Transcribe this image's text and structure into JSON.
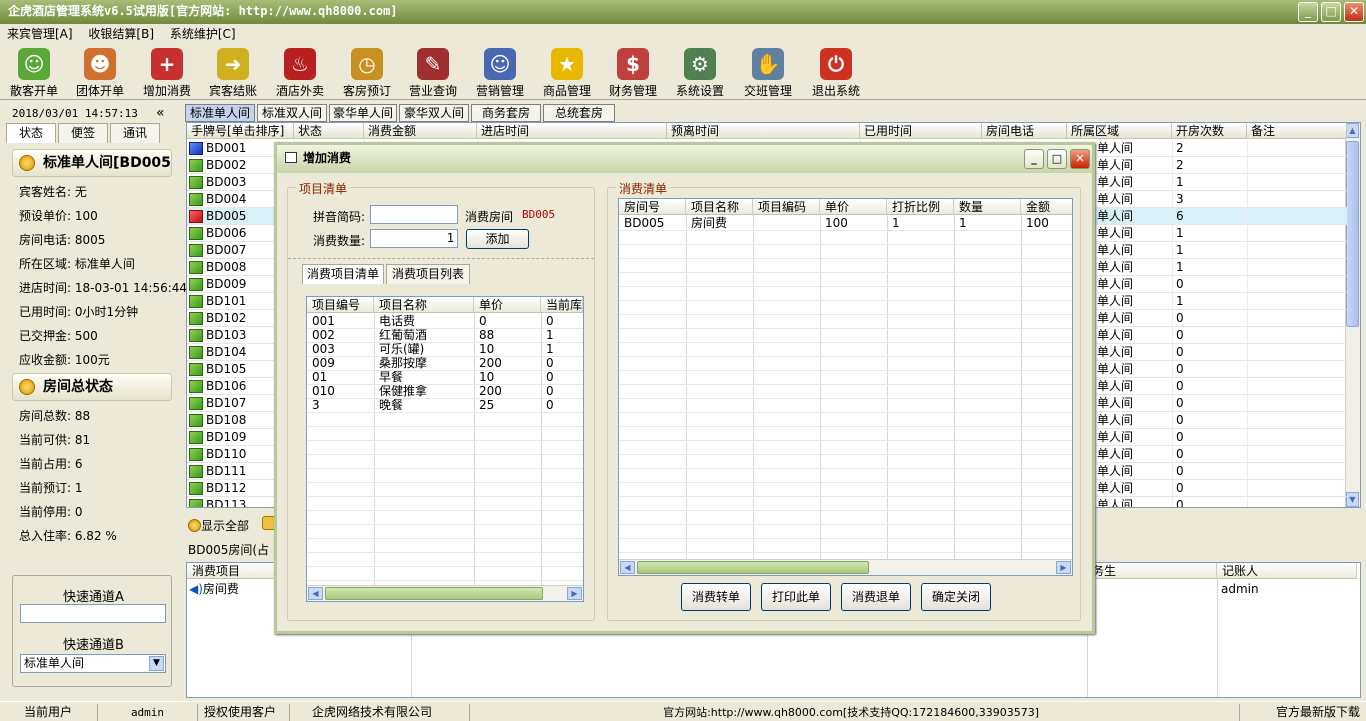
{
  "app": {
    "title": "企虎酒店管理系统v6.5试用版[官方网站: http://www.qh8000.com]"
  },
  "window_buttons": {
    "min": "_",
    "max": "□",
    "close": "✕"
  },
  "menu": [
    "来宾管理[A]",
    "收银结算[B]",
    "系统维护[C]"
  ],
  "toolbar": [
    {
      "label": "散客开单",
      "icon": "person-icon",
      "color": "#5aa838"
    },
    {
      "label": "团体开单",
      "icon": "group-icon",
      "color": "#d07030"
    },
    {
      "label": "增加消费",
      "icon": "add-cart-icon",
      "color": "#c83030"
    },
    {
      "label": "宾客结账",
      "icon": "arrow-icon",
      "color": "#d0b020"
    },
    {
      "label": "酒店外卖",
      "icon": "food-icon",
      "color": "#b82020"
    },
    {
      "label": "客房预订",
      "icon": "clock-icon",
      "color": "#c89020"
    },
    {
      "label": "营业查询",
      "icon": "query-icon",
      "color": "#a03030"
    },
    {
      "label": "营销管理",
      "icon": "people-icon",
      "color": "#4868b0"
    },
    {
      "label": "商品管理",
      "icon": "star-icon",
      "color": "#e8b800"
    },
    {
      "label": "财务管理",
      "icon": "finance-icon",
      "color": "#c04040"
    },
    {
      "label": "系统设置",
      "icon": "settings-icon",
      "color": "#508050"
    },
    {
      "label": "交班管理",
      "icon": "handshake-icon",
      "color": "#6080a0"
    },
    {
      "label": "退出系统",
      "icon": "power-icon",
      "color": "#d03020"
    }
  ],
  "left": {
    "datetime": "2018/03/01 14:57:13",
    "collapse": "«",
    "tabs": [
      "状态",
      "便签",
      "通讯"
    ],
    "room_title": "标准单人间[BD005",
    "room_fields": [
      "宾客姓名: 无",
      "预设单价: 100",
      "房间电话: 8005",
      "所在区域: 标准单人间",
      "进店时间: 18-03-01 14:56:44",
      "已用时间: 0小时1分钟",
      "已交押金: 500",
      "应收金额: 100元"
    ],
    "status_title": "房间总状态",
    "status_fields": [
      "房间总数: 88",
      "当前可供: 81",
      "当前占用: 6",
      "当前预订: 1",
      "当前停用: 0",
      "总入住率: 6.82 %"
    ],
    "fast_a_label": "快速通道A",
    "fast_a_value": "",
    "fast_b_label": "快速通道B",
    "fast_b_value": "标准单人间"
  },
  "room_tabs": [
    "标准单人间",
    "标准双人间",
    "豪华单人间",
    "豪华双人间",
    "商务套房",
    "总统套房"
  ],
  "grid": {
    "headers": [
      "手牌号[单击排序]",
      "状态",
      "消费金额",
      "进店时间",
      "预离时间",
      "已用时间",
      "房间电话",
      "所属区域",
      "开房次数",
      "备注"
    ],
    "rows": [
      {
        "id": "BD001",
        "area": "单人间",
        "count": "2",
        "color": "blue"
      },
      {
        "id": "BD002",
        "area": "单人间",
        "count": "2",
        "color": "green"
      },
      {
        "id": "BD003",
        "area": "单人间",
        "count": "1",
        "color": "green"
      },
      {
        "id": "BD004",
        "area": "单人间",
        "count": "3",
        "color": "green"
      },
      {
        "id": "BD005",
        "area": "单人间",
        "count": "6",
        "color": "red"
      },
      {
        "id": "BD006",
        "area": "单人间",
        "count": "1",
        "color": "green"
      },
      {
        "id": "BD007",
        "area": "单人间",
        "count": "1",
        "color": "green"
      },
      {
        "id": "BD008",
        "area": "单人间",
        "count": "1",
        "color": "green"
      },
      {
        "id": "BD009",
        "area": "单人间",
        "count": "0",
        "color": "green"
      },
      {
        "id": "BD101",
        "area": "单人间",
        "count": "1",
        "color": "green"
      },
      {
        "id": "BD102",
        "area": "单人间",
        "count": "0",
        "color": "green"
      },
      {
        "id": "BD103",
        "area": "单人间",
        "count": "0",
        "color": "green"
      },
      {
        "id": "BD104",
        "area": "单人间",
        "count": "0",
        "color": "green"
      },
      {
        "id": "BD105",
        "area": "单人间",
        "count": "0",
        "color": "green"
      },
      {
        "id": "BD106",
        "area": "单人间",
        "count": "0",
        "color": "green"
      },
      {
        "id": "BD107",
        "area": "单人间",
        "count": "0",
        "color": "green"
      },
      {
        "id": "BD108",
        "area": "单人间",
        "count": "0",
        "color": "green"
      },
      {
        "id": "BD109",
        "area": "单人间",
        "count": "0",
        "color": "green"
      },
      {
        "id": "BD110",
        "area": "单人间",
        "count": "0",
        "color": "green"
      },
      {
        "id": "BD111",
        "area": "单人间",
        "count": "0",
        "color": "green"
      },
      {
        "id": "BD112",
        "area": "单人间",
        "count": "0",
        "color": "green"
      },
      {
        "id": "BD113",
        "area": "单人间",
        "count": "0",
        "color": "green"
      }
    ]
  },
  "bottom": {
    "show_all": "显示全部",
    "room_info": "BD005房间(占",
    "headers": [
      "消费项目",
      "务生",
      "记账人"
    ],
    "row": {
      "item": "房间费",
      "user": "admin"
    }
  },
  "dialog": {
    "title": "增加消费",
    "project_group": "项目清单",
    "pinyin_label": "拼音简码:",
    "pinyin_value": "",
    "room_label": "消费房间",
    "room_value": "BD005",
    "qty_label": "消费数量:",
    "qty_value": "1",
    "add_button": "添加",
    "tabs": [
      "消费项目清单",
      "消费项目列表"
    ],
    "items_headers": [
      "项目编号",
      "项目名称",
      "单价",
      "当前库"
    ],
    "items": [
      [
        "001",
        "电话费",
        "0",
        "0"
      ],
      [
        "002",
        "红葡萄酒",
        "88",
        "1"
      ],
      [
        "003",
        "可乐(罐)",
        "10",
        "1"
      ],
      [
        "009",
        "桑那按摩",
        "200",
        "0"
      ],
      [
        "01",
        "早餐",
        "10",
        "0"
      ],
      [
        "010",
        "保健推拿",
        "200",
        "0"
      ],
      [
        "3",
        "晚餐",
        "25",
        "0"
      ]
    ],
    "consume_group": "消费清单",
    "consume_headers": [
      "房间号",
      "项目名称",
      "项目编码",
      "单价",
      "打折比例",
      "数量",
      "金额"
    ],
    "consume_rows": [
      [
        "BD005",
        "房间费",
        "",
        "100",
        "1",
        "1",
        "100"
      ]
    ],
    "buttons": [
      "消费转单",
      "打印此单",
      "消费退单",
      "确定关闭"
    ]
  },
  "statusbar": {
    "user_label": "当前用户",
    "user": "admin",
    "client_label": "授权使用客户",
    "company": "企虎网络技术有限公司",
    "website": "官方网站:http://www.qh8000.com[技术支持QQ:172184600,33903573]",
    "download": "官方最新版下载"
  }
}
